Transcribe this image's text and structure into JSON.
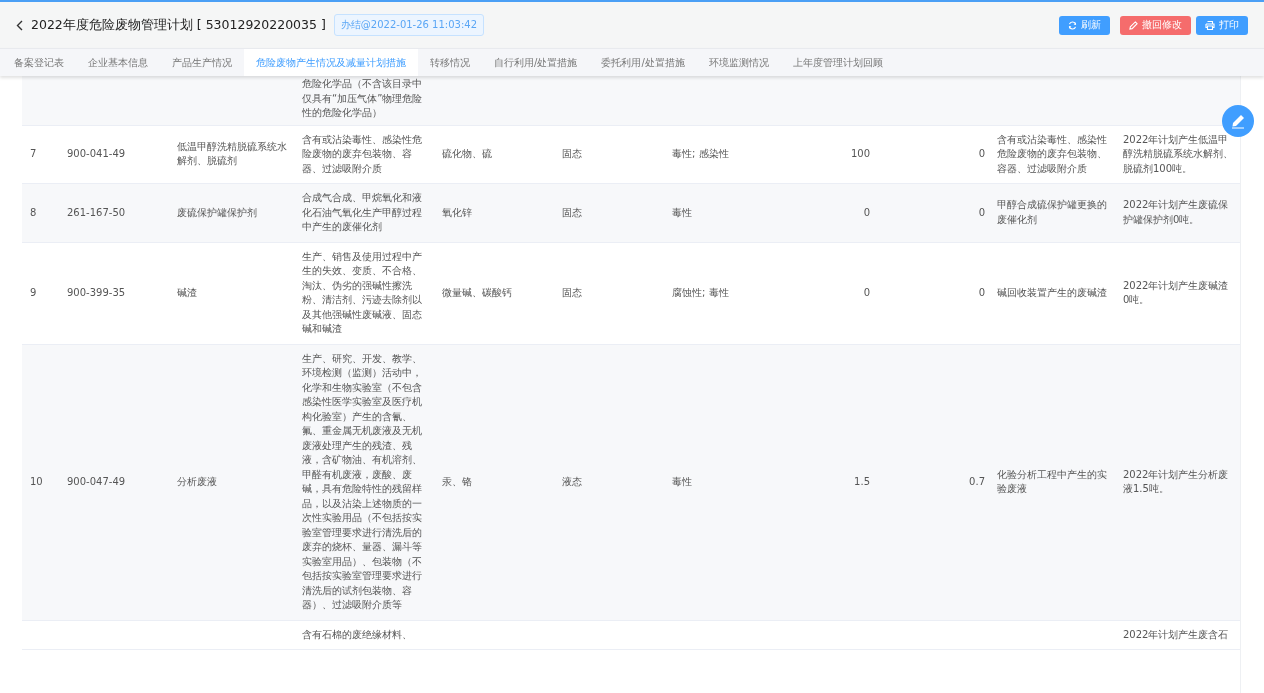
{
  "header": {
    "title": "2022年度危险废物管理计划 [ 53012920220035 ]",
    "status_badge": "办结@2022-01-26 11:03:42",
    "buttons": [
      {
        "kind": "refresh",
        "label": "刷新"
      },
      {
        "kind": "revoke",
        "label": "撤回修改"
      },
      {
        "kind": "print",
        "label": "打印"
      }
    ]
  },
  "tabs": [
    {
      "label": "备案登记表",
      "selected": false
    },
    {
      "label": "企业基本信息",
      "selected": false
    },
    {
      "label": "产品生产情况",
      "selected": false
    },
    {
      "label": "危险废物产生情况及减量计划措施",
      "selected": true
    },
    {
      "label": "转移情况",
      "selected": false
    },
    {
      "label": "自行利用/处置措施",
      "selected": false
    },
    {
      "label": "委托利用/处置措施",
      "selected": false
    },
    {
      "label": "环境监测情况",
      "selected": false
    },
    {
      "label": "上年度管理计划回顾",
      "selected": false
    }
  ],
  "table": {
    "rows": [
      {
        "column_4": "危险化学品（不含该目录中仅具有“加压气体”物理危险性的危险化学品）"
      },
      {
        "column_1": "7",
        "column_2": "900-041-49",
        "column_3": "低温甲醇洗精脱硫系统水解剂、脱硫剂",
        "column_4": "含有或沾染毒性、感染性危险废物的废弃包装物、容器、过滤吸附介质",
        "column_5": "硫化物、硫",
        "column_6": "固态",
        "column_7": "毒性; 感染性",
        "column_8": "100",
        "column_9": "0",
        "column_10": "含有或沾染毒性、感染性危险废物的废弃包装物、容器、过滤吸附介质",
        "column_11": "2022年计划产生低温甲醇洗精脱硫系统水解剂、脱硫剂100吨。"
      },
      {
        "column_1": "8",
        "column_2": "261-167-50",
        "column_3": "废硫保护罐保护剂",
        "column_4": "合成气合成、甲烷氧化和液化石油气氧化生产甲醇过程中产生的废催化剂",
        "column_5": "氧化锌",
        "column_6": "固态",
        "column_7": "毒性",
        "column_8": "0",
        "column_9": "0",
        "column_10": "甲醇合成硫保护罐更换的废催化剂",
        "column_11": "2022年计划产生废硫保护罐保护剂0吨。"
      },
      {
        "column_1": "9",
        "column_2": "900-399-35",
        "column_3": "碱渣",
        "column_4": "生产、销售及使用过程中产生的失效、变质、不合格、淘汰、伪劣的强碱性擦洗粉、清洁剂、污迹去除剂以及其他强碱性废碱液、固态碱和碱渣",
        "column_5": "微量碱、碳酸钙",
        "column_6": "固态",
        "column_7": "腐蚀性; 毒性",
        "column_8": "0",
        "column_9": "0",
        "column_10": "碱回收装置产生的废碱渣",
        "column_11": "2022年计划产生废碱渣0吨。"
      },
      {
        "column_1": "10",
        "column_2": "900-047-49",
        "column_3": "分析废液",
        "column_4": "生产、研究、开发、教学、环境检测（监测）活动中，化学和生物实验室（不包含感染性医学实验室及医疗机构化验室）产生的含氰、氟、重金属无机废液及无机废液处理产生的残渣、残液，含矿物油、有机溶剂、甲醛有机废液，废酸、废碱，具有危险特性的残留样品，以及沾染上述物质的一次性实验用品（不包括按实验室管理要求进行清洗后的废弃的烧杯、量器、漏斗等实验室用品）、包装物（不包括按实验室管理要求进行清洗后的试剂包装物、容器）、过滤吸附介质等",
        "column_5": "汞、铬",
        "column_6": "液态",
        "column_7": "毒性",
        "column_8": "1.5",
        "column_9": "0.7",
        "column_10": "化验分析工程中产生的实验废液",
        "column_11": "2022年计划产生分析废液1.5吨。"
      },
      {
        "column_4": "含有石棉的废绝缘材料、",
        "column_11": "2022年计划产生废含石"
      }
    ]
  }
}
